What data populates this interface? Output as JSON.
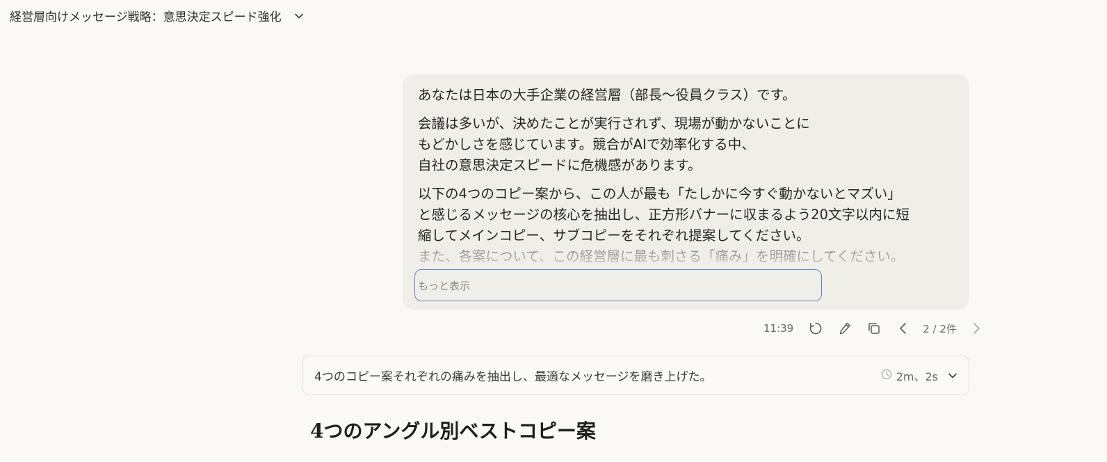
{
  "header": {
    "title": "経営層向けメッセージ戦略：意思決定スピード強化",
    "title_menu_icon": "chevron-down-icon"
  },
  "user_message": {
    "paragraphs": [
      "あなたは日本の大手企業の経営層（部長〜役員クラス）です。",
      "会議は多いが、決めたことが実行されず、現場が動かないことに\nもどかしさを感じています。競合がAIで効率化する中、\n自社の意思決定スピードに危機感があります。",
      "以下の4つのコピー案から、この人が最も「たしかに今すぐ動かないとマズい」\nと感じるメッセージの核心を抽出し、正方形バナーに収まるよう20文字以内に短\n縮してメインコピー、サブコピーをそれぞれ提案してください。",
      "また、各案について、この経営層に最も刺さる「痛み」を明確にしてください。"
    ],
    "show_more_label": "もっと表示"
  },
  "message_meta": {
    "time": "11:39",
    "retry_icon": "retry-icon",
    "edit_icon": "pencil-icon",
    "copy_icon": "copy-icon",
    "pager_text": "2 / 2件",
    "prev_icon": "chevron-left-icon",
    "next_icon": "chevron-right-icon"
  },
  "thinking": {
    "summary": "4つのコピー案それぞれの痛みを抽出し、最適なメッセージを磨き上げた。",
    "duration": "2m、2s",
    "clock_icon": "clock-icon",
    "expand_icon": "chevron-down-icon"
  },
  "answer": {
    "heading": "4つのアングル別ベストコピー案"
  },
  "colors": {
    "background": "#faf9f6",
    "bubble": "#f0eee9",
    "focus_ring": "#5b82c4",
    "text": "#262522",
    "muted": "#6b6963"
  }
}
